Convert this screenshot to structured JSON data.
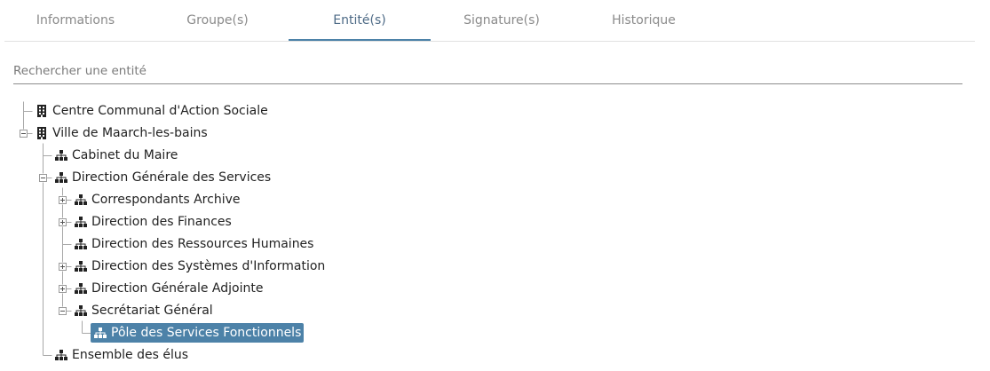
{
  "tabs": [
    {
      "label": "Informations",
      "active": false
    },
    {
      "label": "Groupe(s)",
      "active": false
    },
    {
      "label": "Entité(s)",
      "active": true
    },
    {
      "label": "Signature(s)",
      "active": false
    },
    {
      "label": "Historique",
      "active": false
    }
  ],
  "search": {
    "placeholder": "Rechercher une entité",
    "value": ""
  },
  "tree": [
    {
      "label": "Centre Communal d'Action Sociale",
      "icon": "building-icon",
      "level": 0,
      "toggle": "none"
    },
    {
      "label": "Ville de Maarch-les-bains",
      "icon": "building-icon",
      "level": 0,
      "toggle": "expanded"
    },
    {
      "label": "Cabinet du Maire",
      "icon": "sitemap-icon",
      "level": 1,
      "toggle": "none"
    },
    {
      "label": "Direction Générale des Services",
      "icon": "sitemap-icon",
      "level": 1,
      "toggle": "expanded"
    },
    {
      "label": "Correspondants Archive",
      "icon": "sitemap-icon",
      "level": 2,
      "toggle": "collapsed"
    },
    {
      "label": "Direction des Finances",
      "icon": "sitemap-icon",
      "level": 2,
      "toggle": "collapsed"
    },
    {
      "label": "Direction des Ressources Humaines",
      "icon": "sitemap-icon",
      "level": 2,
      "toggle": "none"
    },
    {
      "label": "Direction des Systèmes d'Information",
      "icon": "sitemap-icon",
      "level": 2,
      "toggle": "collapsed"
    },
    {
      "label": "Direction Générale Adjointe",
      "icon": "sitemap-icon",
      "level": 2,
      "toggle": "collapsed"
    },
    {
      "label": "Secrétariat Général",
      "icon": "sitemap-icon",
      "level": 2,
      "toggle": "expanded"
    },
    {
      "label": "Pôle des Services Fonctionnels",
      "icon": "sitemap-icon",
      "level": 3,
      "toggle": "none",
      "selected": true
    },
    {
      "label": "Ensemble des élus",
      "icon": "sitemap-icon",
      "level": 1,
      "toggle": "none"
    }
  ],
  "colors": {
    "accent": "#4d82a8",
    "tab_active_text": "#4d6a86",
    "tab_text": "#8a8a8a"
  }
}
